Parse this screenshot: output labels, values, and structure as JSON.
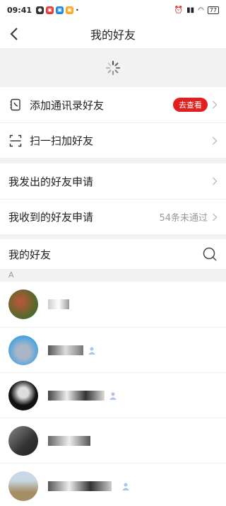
{
  "status": {
    "time": "09:41",
    "battery": "77"
  },
  "header": {
    "title": "我的好友"
  },
  "menu": {
    "add_contacts": {
      "label": "添加通讯录好友",
      "badge": "去查看"
    },
    "scan": {
      "label": "扫一扫加好友"
    },
    "sent": {
      "label": "我发出的好友申请"
    },
    "received": {
      "label": "我收到的好友申请",
      "status": "54条未通过"
    }
  },
  "friends_section": {
    "title": "我的好友",
    "index_letter": "A"
  },
  "friends": [
    {
      "name": ""
    },
    {
      "name": ""
    },
    {
      "name": ""
    },
    {
      "name": ""
    },
    {
      "name": ""
    }
  ],
  "colors": {
    "accent": "#e02020",
    "avatars": [
      "#b8462e",
      "#4aa3df",
      "#222222",
      "#555555",
      "#8c7a5a"
    ]
  }
}
